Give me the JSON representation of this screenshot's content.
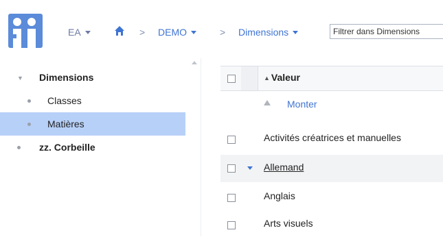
{
  "header": {
    "org_label": "EA",
    "separator": ">",
    "breadcrumb_demo": "DEMO",
    "breadcrumb_dimensions": "Dimensions",
    "filter_placeholder": "Filtrer dans Dimensions"
  },
  "tree": {
    "items": [
      {
        "label": "Dimensions",
        "marker": "▼"
      },
      {
        "label": "Classes"
      },
      {
        "label": "Matières",
        "selected": true
      },
      {
        "label": "zz. Corbeille"
      }
    ]
  },
  "table": {
    "sort_arrow": "▲",
    "column_header": "Valeur",
    "sort_action": "Monter",
    "rows": [
      {
        "label": "Activités créatrices et manuelles"
      },
      {
        "label": "Allemand",
        "highlighted": true
      },
      {
        "label": "Anglais"
      },
      {
        "label": "Arts visuels"
      }
    ]
  },
  "colors": {
    "accent": "#3f74d2",
    "logo_bg": "#5b8bd9",
    "selection": "#b7d0f8"
  },
  "icons": [
    "app-logo",
    "home-icon",
    "caret-down-icon",
    "tree-collapse-icon",
    "sort-up-icon",
    "expand-caret-icon"
  ]
}
